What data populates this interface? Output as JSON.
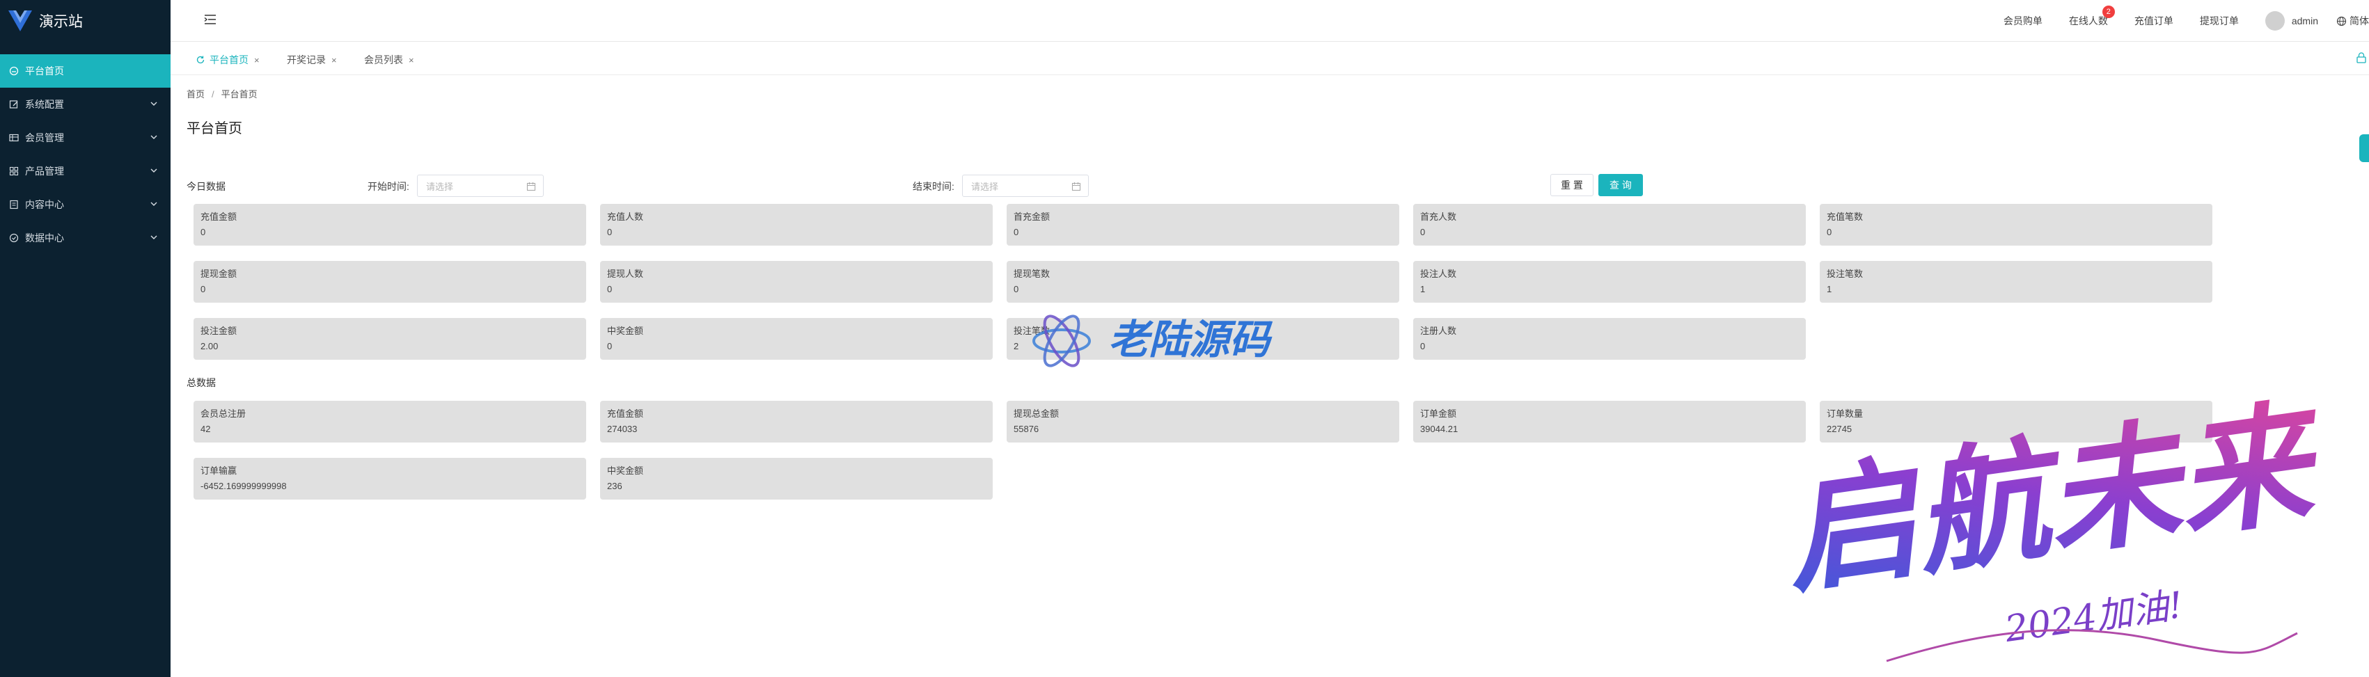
{
  "app": {
    "title": "演示站",
    "accent_color": "#1bb4bd",
    "sidebar_color": "#0c2130"
  },
  "sidebar": {
    "items": [
      {
        "label": "平台首页",
        "icon": "home-icon",
        "active": true
      },
      {
        "label": "系统配置",
        "icon": "edit-icon"
      },
      {
        "label": "会员管理",
        "icon": "table-icon"
      },
      {
        "label": "产品管理",
        "icon": "grid-icon"
      },
      {
        "label": "内容中心",
        "icon": "document-icon"
      },
      {
        "label": "数据中心",
        "icon": "check-circle-icon"
      }
    ]
  },
  "header": {
    "links": [
      "会员购单",
      "在线人数",
      "充值订单",
      "提现订单"
    ],
    "online_badge": "2",
    "user": "admin",
    "lang": "简体"
  },
  "tabs": [
    {
      "label": "平台首页",
      "active": true
    },
    {
      "label": "开奖记录"
    },
    {
      "label": "会员列表"
    }
  ],
  "tab_close": "×",
  "breadcrumb": [
    "首页",
    "平台首页"
  ],
  "breadcrumb_sep": "/",
  "page_title": "平台首页",
  "filters": {
    "section_today": "今日数据",
    "start_label": "开始时间:",
    "end_label": "结束时间:",
    "placeholder": "请选择",
    "reset": "重 置",
    "query": "查 询"
  },
  "today_cards": [
    {
      "label": "充值金额",
      "value": "0"
    },
    {
      "label": "充值人数",
      "value": "0"
    },
    {
      "label": "首充金额",
      "value": "0"
    },
    {
      "label": "首充人数",
      "value": "0"
    },
    {
      "label": "充值笔数",
      "value": "0"
    },
    {
      "label": "提现金额",
      "value": "0"
    },
    {
      "label": "提现人数",
      "value": "0"
    },
    {
      "label": "提现笔数",
      "value": "0"
    },
    {
      "label": "投注人数",
      "value": "1"
    },
    {
      "label": "投注笔数",
      "value": "1"
    },
    {
      "label": "投注金额",
      "value": "2.00"
    },
    {
      "label": "中奖金额",
      "value": "0"
    },
    {
      "label": "投注笔数",
      "value": "2"
    },
    {
      "label": "注册人数",
      "value": "0"
    }
  ],
  "section_total": "总数据",
  "total_cards": [
    {
      "label": "会员总注册",
      "value": "42"
    },
    {
      "label": "充值金额",
      "value": "274033"
    },
    {
      "label": "提现总金额",
      "value": "55876"
    },
    {
      "label": "订单金额",
      "value": "39044.21"
    },
    {
      "label": "订单数量",
      "value": "22745"
    },
    {
      "label": "订单输赢",
      "value": "-6452.169999999998"
    },
    {
      "label": "中奖金额",
      "value": "236"
    }
  ],
  "watermarks": {
    "center_text": "老陆源码",
    "corner_text": "启航未来",
    "corner_sub": "2024加油!"
  }
}
